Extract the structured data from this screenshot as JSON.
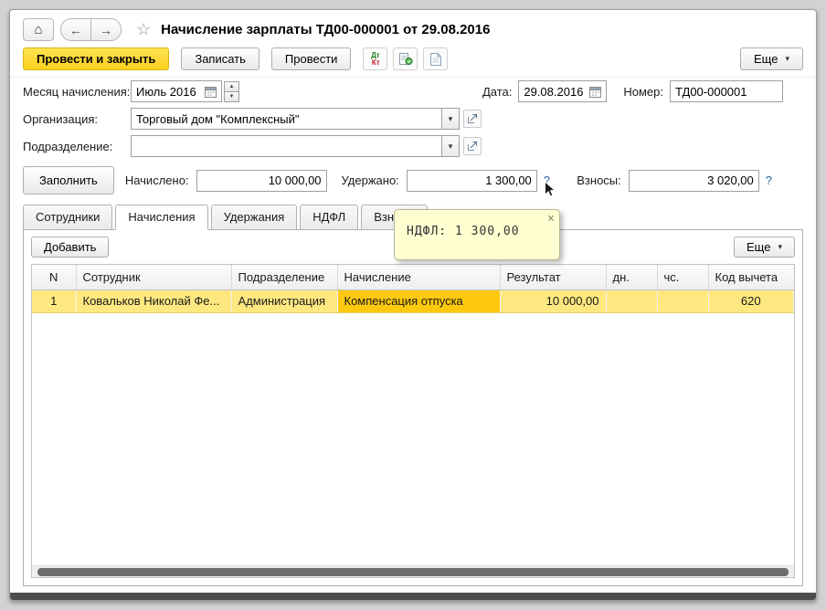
{
  "icons": {
    "home": "⌂",
    "back": "←",
    "forward": "→",
    "star": "☆",
    "chevron_down": "▾",
    "spin_up": "▲",
    "spin_down": "▼"
  },
  "titlebar": {
    "title": "Начисление зарплаты ТД00-000001 от 29.08.2016"
  },
  "toolbar": {
    "post_and_close": "Провести и закрыть",
    "write": "Записать",
    "post": "Провести",
    "dt": "Дт",
    "kt": "Кт",
    "more": "Еще"
  },
  "form": {
    "month": {
      "label": "Месяц начисления:",
      "value": "Июль 2016"
    },
    "date": {
      "label": "Дата:",
      "value": "29.08.2016"
    },
    "number": {
      "label": "Номер:",
      "value": "ТД00-000001"
    },
    "organization": {
      "label": "Организация:",
      "value": "Торговый дом \"Комплексный\""
    },
    "department": {
      "label": "Подразделение:",
      "value": ""
    }
  },
  "totals": {
    "fill": "Заполнить",
    "accrued_label": "Начислено:",
    "accrued_value": "10 000,00",
    "withheld_label": "Удержано:",
    "withheld_value": "1 300,00",
    "withheld_help": "?",
    "contributions_label": "Взносы:",
    "contributions_value": "3 020,00",
    "contributions_help": "?"
  },
  "tooltip": {
    "text": "НДФЛ: 1 300,00",
    "close": "×"
  },
  "tabs": [
    {
      "label": "Сотрудники"
    },
    {
      "label": "Начисления"
    },
    {
      "label": "Удержания"
    },
    {
      "label": "НДФЛ"
    },
    {
      "label": "Взносы"
    }
  ],
  "grid": {
    "add": "Добавить",
    "more": "Еще",
    "headers": [
      "N",
      "Сотрудник",
      "Подразделение",
      "Начисление",
      "Результат",
      "дн.",
      "чс.",
      "Код вычета"
    ],
    "rows": [
      {
        "n": "1",
        "employee": "Ковальков  Николай Фе...",
        "department": "Администрация",
        "accrual": "Компенсация отпуска",
        "result": "10 000,00",
        "days": "",
        "hours": "",
        "code": "620"
      }
    ]
  },
  "colors": {
    "primary_button": "#fccf1f",
    "row_highlight": "#ffe880",
    "active_cell": "#fdc90e",
    "tooltip_bg": "#ffffd2",
    "help_link": "#2d66a3"
  }
}
